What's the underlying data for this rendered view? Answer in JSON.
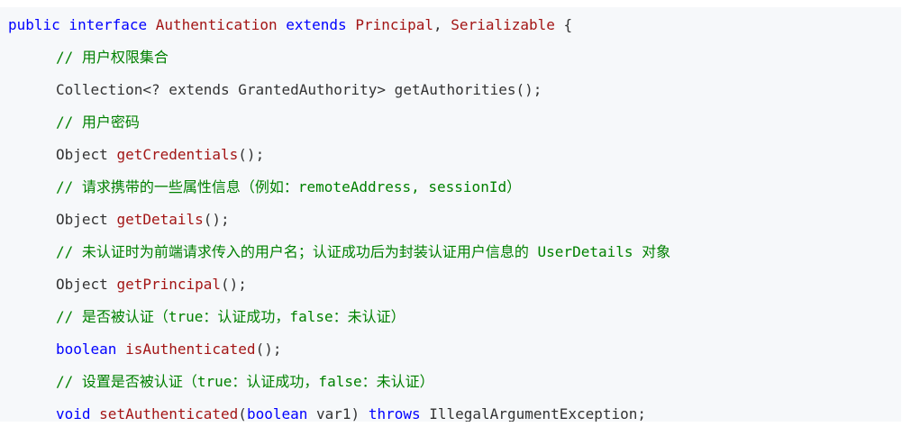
{
  "colors": {
    "background": "#ffffff",
    "code_background": "#f6f8fa",
    "keyword": "#0000ff",
    "type_name": "#a31515",
    "method_name": "#a31515",
    "comment": "#008000",
    "plain": "#333333"
  },
  "code": {
    "lines": [
      {
        "indent": 0,
        "tokens": [
          {
            "text": "public interface ",
            "kind": "keyword"
          },
          {
            "text": "Authentication",
            "kind": "type_name"
          },
          {
            "text": " extends ",
            "kind": "keyword"
          },
          {
            "text": "Principal",
            "kind": "type_name"
          },
          {
            "text": ", ",
            "kind": "plain"
          },
          {
            "text": "Serializable",
            "kind": "type_name"
          },
          {
            "text": " {",
            "kind": "plain"
          }
        ]
      },
      {
        "indent": 1,
        "tokens": [
          {
            "text": "// 用户权限集合",
            "kind": "comment"
          }
        ]
      },
      {
        "indent": 1,
        "tokens": [
          {
            "text": "Collection<? extends GrantedAuthority> getAuthorities();",
            "kind": "plain"
          }
        ]
      },
      {
        "indent": 1,
        "tokens": [
          {
            "text": "// 用户密码",
            "kind": "comment"
          }
        ]
      },
      {
        "indent": 1,
        "tokens": [
          {
            "text": "Object ",
            "kind": "plain"
          },
          {
            "text": "getCredentials",
            "kind": "method_name"
          },
          {
            "text": "();",
            "kind": "plain"
          }
        ]
      },
      {
        "indent": 1,
        "tokens": [
          {
            "text": "// 请求携带的一些属性信息（例如：remoteAddress, sessionId）",
            "kind": "comment"
          }
        ]
      },
      {
        "indent": 1,
        "tokens": [
          {
            "text": "Object ",
            "kind": "plain"
          },
          {
            "text": "getDetails",
            "kind": "method_name"
          },
          {
            "text": "();",
            "kind": "plain"
          }
        ]
      },
      {
        "indent": 1,
        "tokens": [
          {
            "text": "// 未认证时为前端请求传入的用户名；认证成功后为封装认证用户信息的 UserDetails 对象",
            "kind": "comment"
          }
        ]
      },
      {
        "indent": 1,
        "tokens": [
          {
            "text": "Object ",
            "kind": "plain"
          },
          {
            "text": "getPrincipal",
            "kind": "method_name"
          },
          {
            "text": "();",
            "kind": "plain"
          }
        ]
      },
      {
        "indent": 1,
        "tokens": [
          {
            "text": "// 是否被认证（true：认证成功，false：未认证）",
            "kind": "comment"
          }
        ]
      },
      {
        "indent": 1,
        "tokens": [
          {
            "text": "boolean ",
            "kind": "keyword"
          },
          {
            "text": "isAuthenticated",
            "kind": "method_name"
          },
          {
            "text": "();",
            "kind": "plain"
          }
        ]
      },
      {
        "indent": 1,
        "tokens": [
          {
            "text": "// 设置是否被认证（true：认证成功，false：未认证）",
            "kind": "comment"
          }
        ]
      },
      {
        "indent": 1,
        "tokens": [
          {
            "text": "void ",
            "kind": "keyword"
          },
          {
            "text": "setAuthenticated",
            "kind": "method_name"
          },
          {
            "text": "(",
            "kind": "plain"
          },
          {
            "text": "boolean",
            "kind": "keyword"
          },
          {
            "text": " var1) ",
            "kind": "plain"
          },
          {
            "text": "throws",
            "kind": "keyword"
          },
          {
            "text": " IllegalArgumentException;",
            "kind": "plain"
          }
        ]
      }
    ]
  }
}
